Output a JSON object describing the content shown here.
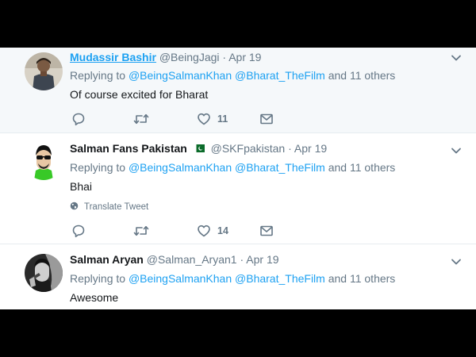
{
  "tweets": [
    {
      "name": "Mudassir Bashir",
      "handle": "@BeingJagi",
      "separator": "·",
      "date": "Apr 19",
      "replying_prefix": "Replying to",
      "mention1": "@BeingSalmanKhan",
      "mention2": "@Bharat_TheFilm",
      "replying_suffix": "and 11 others",
      "text": "Of course excited for Bharat",
      "likes": "11"
    },
    {
      "name": "Salman Fans Pakistan",
      "handle": "@SKFpakistan",
      "separator": "·",
      "date": "Apr 19",
      "replying_prefix": "Replying to",
      "mention1": "@BeingSalmanKhan",
      "mention2": "@Bharat_TheFilm",
      "replying_suffix": "and 11 others",
      "text": "Bhai",
      "translate_label": "Translate Tweet",
      "likes": "14"
    },
    {
      "name": "Salman Aryan",
      "handle": "@Salman_Aryan1",
      "separator": "·",
      "date": "Apr 19",
      "replying_prefix": "Replying to",
      "mention1": "@BeingSalmanKhan",
      "mention2": "@Bharat_TheFilm",
      "replying_suffix": "and 11 others",
      "text": "Awesome"
    }
  ],
  "icons": {
    "reply": "reply-icon",
    "retweet": "retweet-icon",
    "like": "heart-icon",
    "message": "envelope-icon",
    "more": "chevron-down-icon",
    "translate": "globe-icon",
    "flag": "pakistan-flag-icon"
  },
  "colors": {
    "link": "#1da1f2",
    "muted": "#657786",
    "text": "#14171a",
    "highlight_bg": "#f5f8fa",
    "divider": "#e6ecf0"
  }
}
